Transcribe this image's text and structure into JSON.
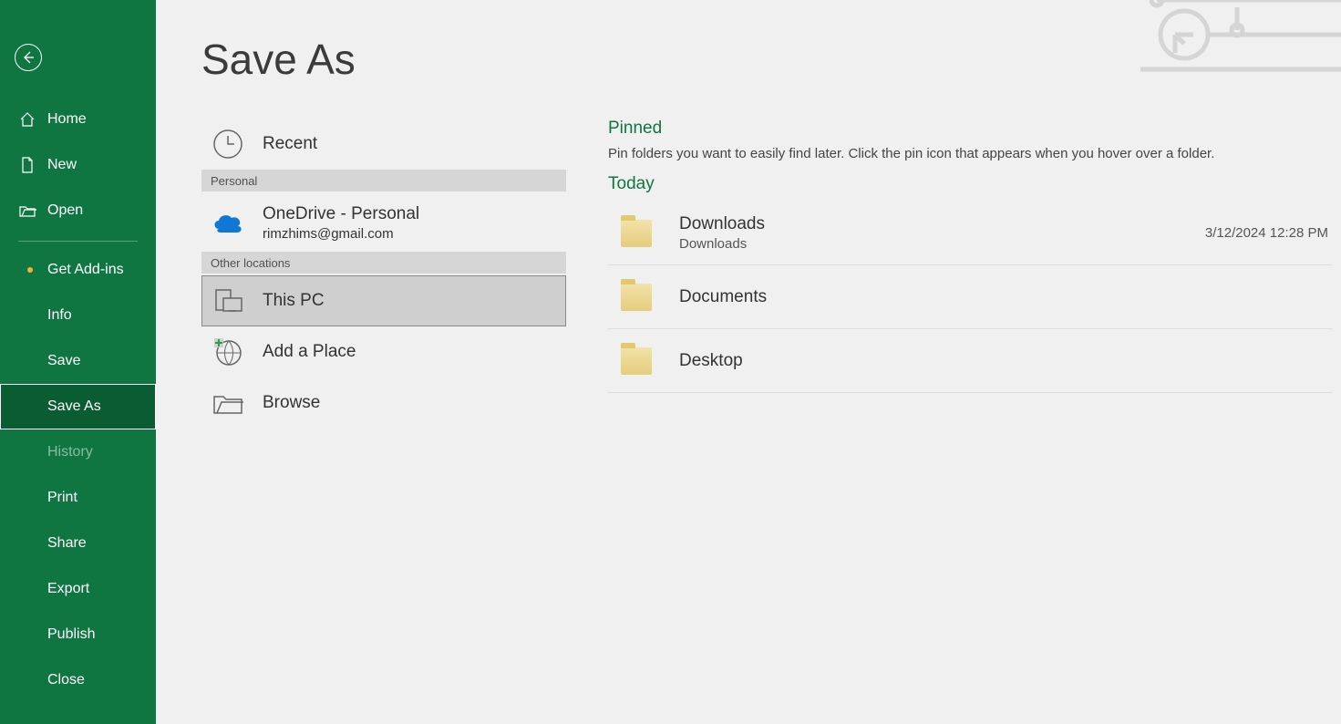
{
  "page": {
    "title": "Save As"
  },
  "sidebar": {
    "home": "Home",
    "new": "New",
    "open": "Open",
    "get_addins": "Get Add-ins",
    "info": "Info",
    "save": "Save",
    "save_as": "Save As",
    "history": "History",
    "print": "Print",
    "share": "Share",
    "export": "Export",
    "publish": "Publish",
    "close": "Close"
  },
  "places": {
    "recent": "Recent",
    "section_personal": "Personal",
    "onedrive": {
      "label": "OneDrive - Personal",
      "email": "rimzhims@gmail.com"
    },
    "section_other": "Other locations",
    "this_pc": "This PC",
    "add_place": "Add a Place",
    "browse": "Browse"
  },
  "folders": {
    "pinned_title": "Pinned",
    "pinned_hint": "Pin folders you want to easily find later. Click the pin icon that appears when you hover over a folder.",
    "today_title": "Today",
    "items": [
      {
        "name": "Downloads",
        "path": "Downloads",
        "date": "3/12/2024 12:28 PM"
      },
      {
        "name": "Documents",
        "path": "",
        "date": ""
      },
      {
        "name": "Desktop",
        "path": "",
        "date": ""
      }
    ]
  }
}
